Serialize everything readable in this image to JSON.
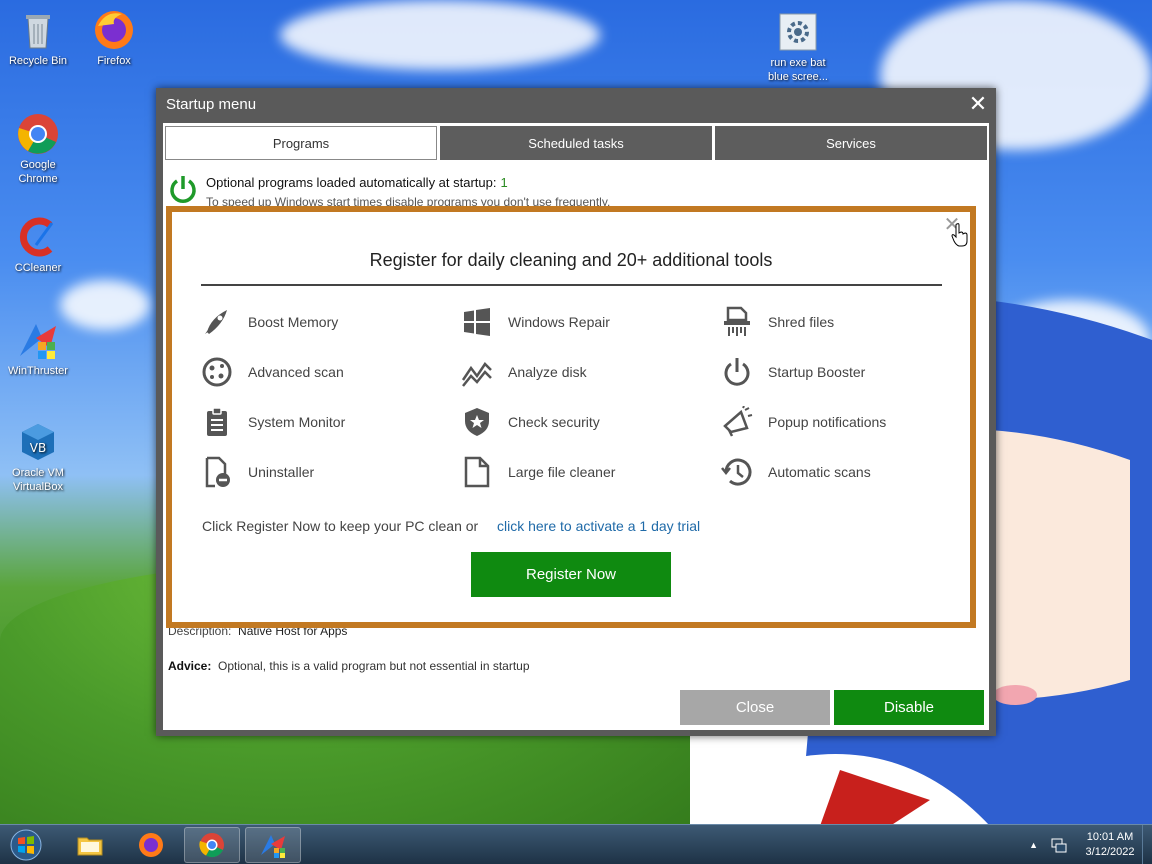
{
  "desktop": {
    "icons": [
      {
        "label": "Recycle Bin",
        "icon": "recycle-bin-icon"
      },
      {
        "label": "Firefox",
        "icon": "firefox-icon"
      },
      {
        "label": "Google Chrome",
        "icon": "chrome-icon"
      },
      {
        "label": "CCleaner",
        "icon": "ccleaner-icon"
      },
      {
        "label": "WinThruster",
        "icon": "winthruster-icon"
      },
      {
        "label": "Oracle VM VirtualBox",
        "icon": "virtualbox-icon"
      },
      {
        "label": "run exe bat blue scree...",
        "icon": "settings-file-icon"
      }
    ]
  },
  "window": {
    "title": "Startup menu",
    "close_glyph": "✕",
    "tabs": [
      {
        "label": "Programs",
        "active": true
      },
      {
        "label": "Scheduled tasks",
        "active": false
      },
      {
        "label": "Services",
        "active": false
      }
    ],
    "optional_label": "Optional programs loaded automatically at startup:",
    "optional_count": "1",
    "optional_sub": "To speed up Windows start times disable programs you don't use frequently.",
    "description_label": "Description:",
    "description_value": "Native Host for Apps",
    "advice_label": "Advice:",
    "advice_value": "Optional,  this is a valid program but not essential in startup",
    "close_button": "Close",
    "disable_button": "Disable"
  },
  "promo": {
    "close_glyph": "✕",
    "title": "Register for daily cleaning and 20+ additional tools",
    "features": [
      {
        "label": "Boost Memory",
        "icon": "rocket-icon"
      },
      {
        "label": "Windows Repair",
        "icon": "windows-icon"
      },
      {
        "label": "Shred files",
        "icon": "shredder-icon"
      },
      {
        "label": "Advanced scan",
        "icon": "scan-icon"
      },
      {
        "label": "Analyze disk",
        "icon": "chart-line-icon"
      },
      {
        "label": "Startup Booster",
        "icon": "power-icon"
      },
      {
        "label": "System Monitor",
        "icon": "clipboard-icon"
      },
      {
        "label": "Check security",
        "icon": "shield-star-icon"
      },
      {
        "label": "Popup notifications",
        "icon": "megaphone-icon"
      },
      {
        "label": "Uninstaller",
        "icon": "file-remove-icon"
      },
      {
        "label": "Large file cleaner",
        "icon": "file-icon"
      },
      {
        "label": "Automatic scans",
        "icon": "history-icon"
      }
    ],
    "cta_text": "Click Register Now to keep your PC clean or",
    "cta_link": "click here to activate a 1 day trial",
    "register_button": "Register Now"
  },
  "taskbar": {
    "time": "10:01 AM",
    "date": "3/12/2022",
    "tray_arrow": "▲"
  },
  "colors": {
    "accent_green": "#0f8a10",
    "promo_border": "#c27922",
    "link_blue": "#1f6aa8",
    "window_frame": "#5a5a5a"
  }
}
